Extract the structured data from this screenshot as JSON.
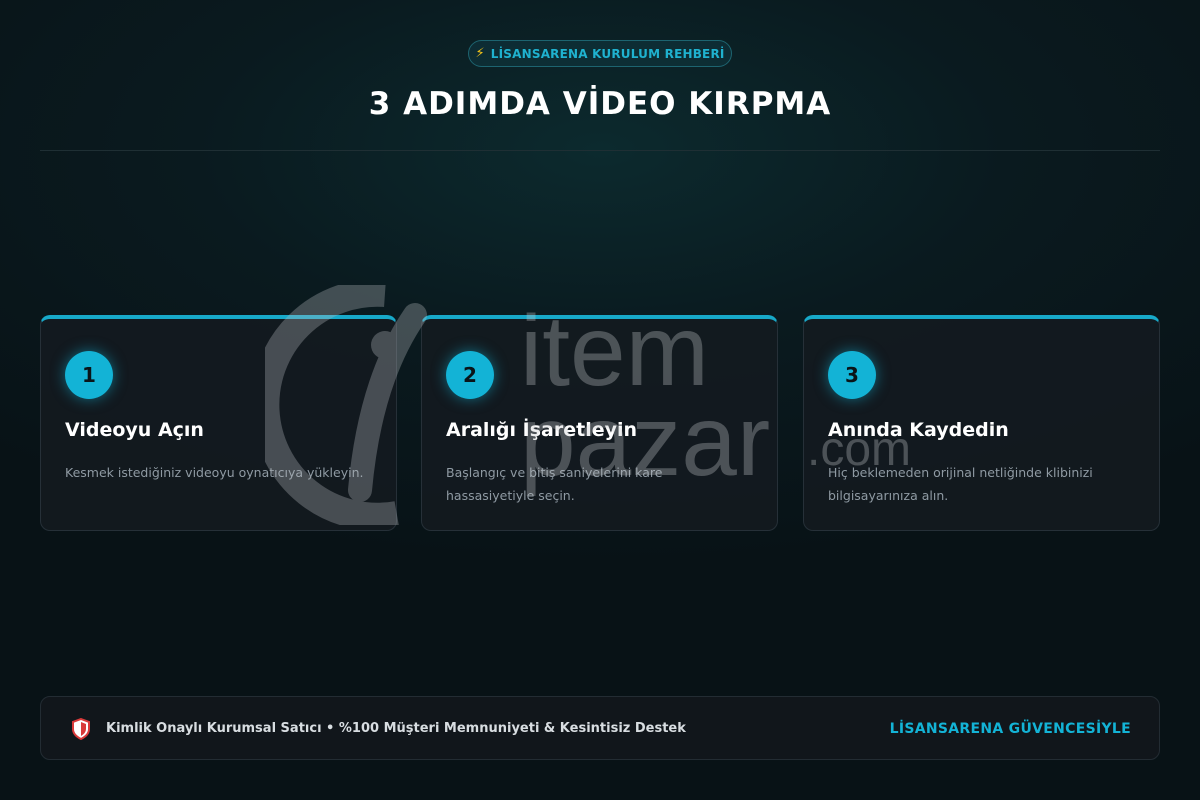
{
  "header": {
    "badge_icon": "lightning-icon",
    "badge_label": "LİSANSARENA KURULUM REHBERİ",
    "title": "3 ADIMDA VİDEO KIRPMA"
  },
  "steps": [
    {
      "number": "1",
      "title": "Videoyu Açın",
      "description": "Kesmek istediğiniz videoyu oynatıcıya yükleyin."
    },
    {
      "number": "2",
      "title": "Aralığı İşaretleyin",
      "description": "Başlangıç ve bitiş saniyelerini kare hassasiyetiyle seçin."
    },
    {
      "number": "3",
      "title": "Anında Kaydedin",
      "description": "Hiç beklemeden orijinal netliğinde klibinizi bilgisayarınıza alın."
    }
  ],
  "watermark": {
    "line1": "item",
    "line2": "pazar",
    "suffix": ".com"
  },
  "footer": {
    "icon": "shield-icon",
    "text": "Kimlik Onaylı Kurumsal Satıcı • %100 Müşteri Memnuniyeti & Kesintisiz Destek",
    "badge": "LİSANSARENA GÜVENCESİYLE"
  },
  "colors": {
    "accent": "#13b3d6",
    "background": "#0a1a1f",
    "card": "#141a20",
    "shield_red": "#d93a3a"
  }
}
